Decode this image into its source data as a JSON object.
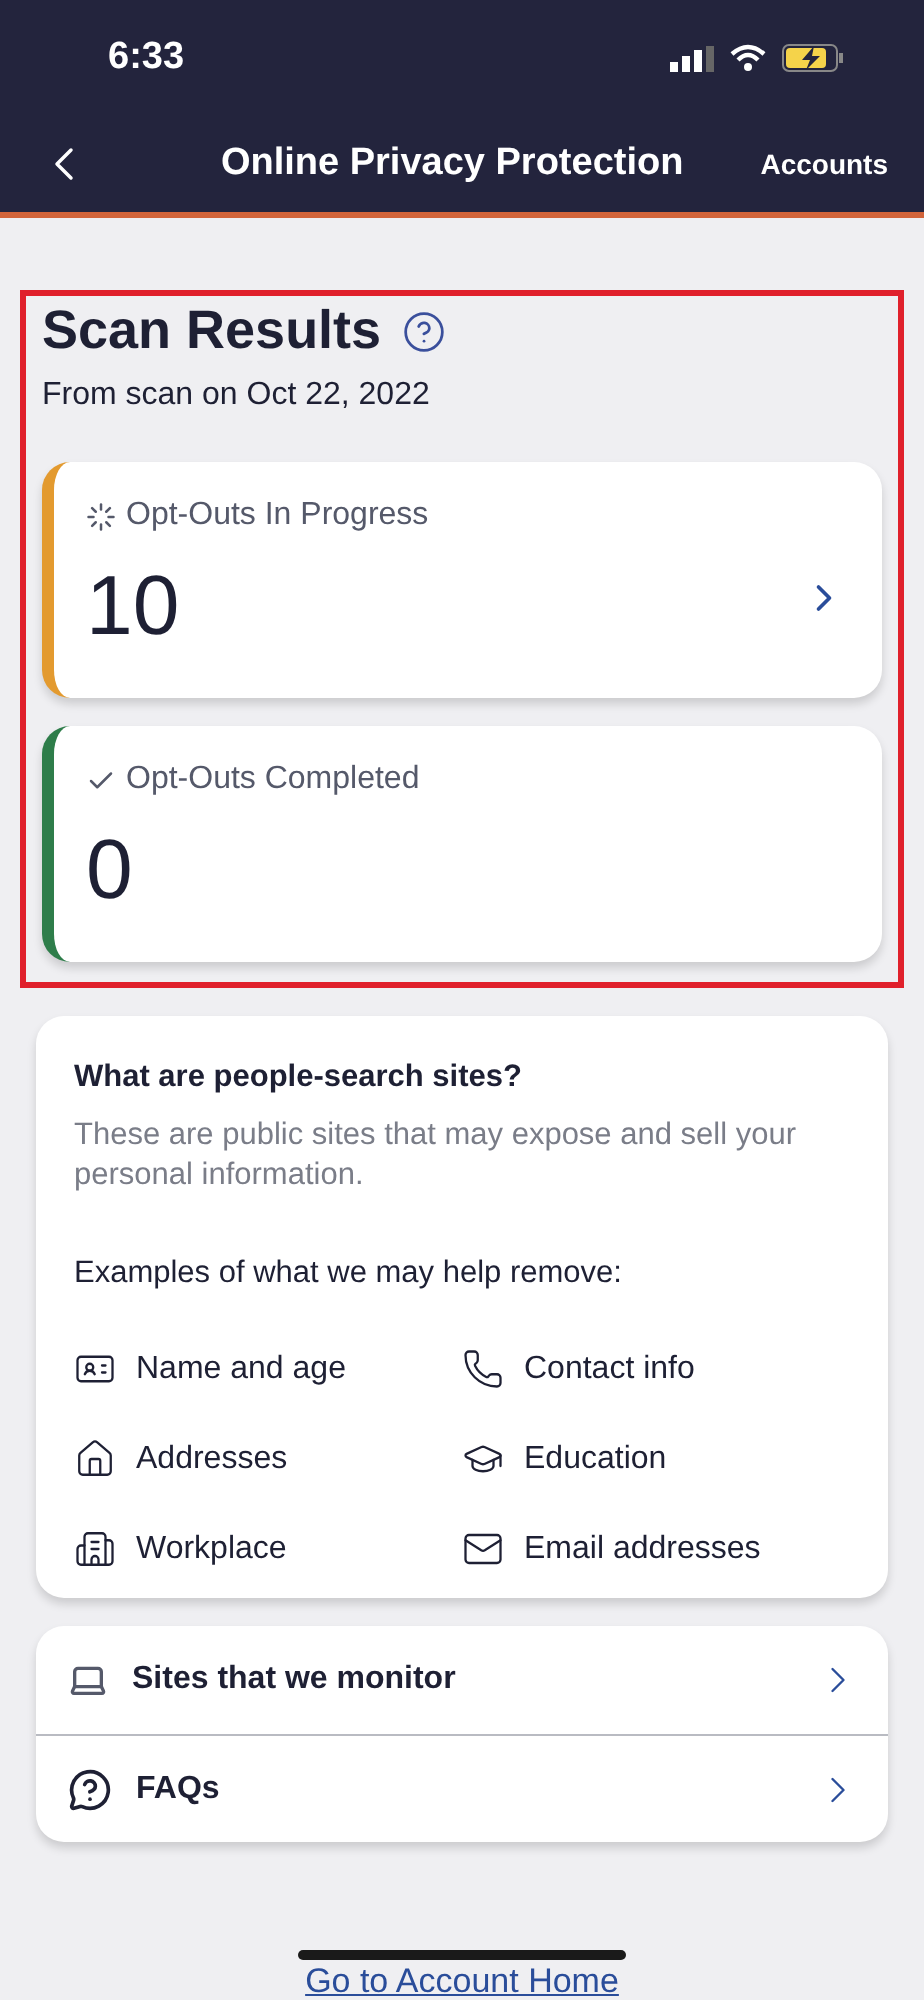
{
  "status_bar": {
    "time": "6:33"
  },
  "nav": {
    "title": "Online Privacy Protection",
    "action": "Accounts"
  },
  "scan_results": {
    "highlighted": true,
    "title": "Scan Results",
    "subtitle": "From scan on Oct 22, 2022",
    "cards": [
      {
        "kind": "progress",
        "label": "Opt-Outs In Progress",
        "count": "10",
        "color": "#e39a2f",
        "has_arrow": true
      },
      {
        "kind": "completed",
        "label": "Opt-Outs Completed",
        "count": "0",
        "color": "#2e7d4a",
        "has_arrow": false
      }
    ]
  },
  "info": {
    "title": "What are people-search sites?",
    "body": "These are public sites that may expose and sell your personal information.",
    "examples_title": "Examples of what we may help remove:",
    "examples": [
      "Name and age",
      "Contact info",
      "Addresses",
      "Education",
      "Workplace",
      "Email addresses"
    ]
  },
  "links": [
    "Sites that we monitor",
    "FAQs"
  ],
  "footer_link": "Go to Account Home"
}
